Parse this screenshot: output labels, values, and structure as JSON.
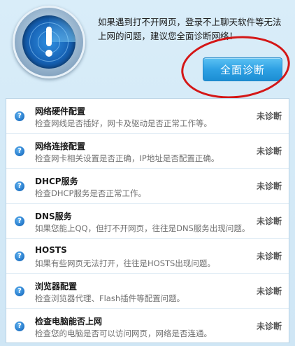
{
  "header": {
    "message": "如果遇到打不开网页，登录不上聊天软件等无法上网的问题，建议您全面诊断网络！",
    "diagnose_button": "全面诊断"
  },
  "colors": {
    "accent": "#2ea1e4",
    "highlight": "#d41717"
  },
  "items": [
    {
      "icon": "question-icon",
      "title": "网络硬件配置",
      "desc": "检查网线是否插好，网卡及驱动是否正常工作等。",
      "status": "未诊断"
    },
    {
      "icon": "question-icon",
      "title": "网络连接配置",
      "desc": "检查网卡相关设置是否正确，IP地址是否配置正确。",
      "status": "未诊断"
    },
    {
      "icon": "question-icon",
      "title": "DHCP服务",
      "desc": "检查DHCP服务是否正常工作。",
      "status": "未诊断"
    },
    {
      "icon": "question-icon",
      "title": "DNS服务",
      "desc": "如果您能上QQ，但打不开网页，往往是DNS服务出现问题。",
      "status": "未诊断"
    },
    {
      "icon": "question-icon",
      "title": "HOSTS",
      "desc": "如果有些网页无法打开，往往是HOSTS出现问题。",
      "status": "未诊断"
    },
    {
      "icon": "question-icon",
      "title": "浏览器配置",
      "desc": "检查浏览器代理、Flash插件等配置问题。",
      "status": "未诊断"
    },
    {
      "icon": "question-icon",
      "title": "检查电脑能否上网",
      "desc": "检查您的电脑是否可以访问网页，网络是否连通。",
      "status": "未诊断"
    }
  ]
}
